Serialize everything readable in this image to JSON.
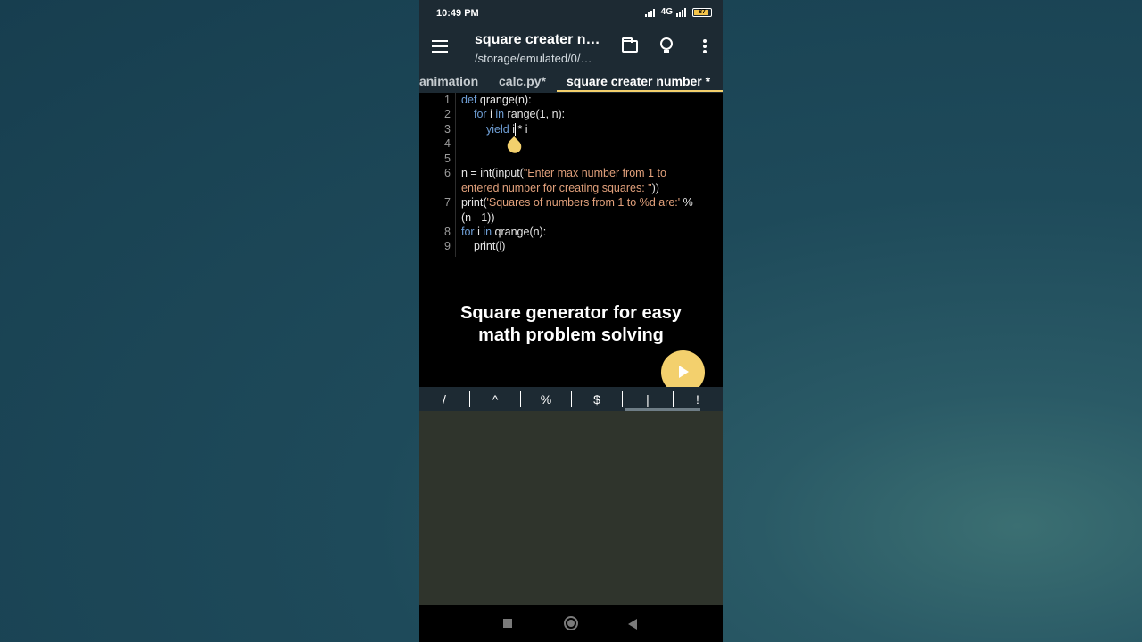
{
  "status_bar": {
    "time": "10:49 PM",
    "network": "4G",
    "battery": "87",
    "battery_level": 0.87
  },
  "app_bar": {
    "title": "square creater n…",
    "subtitle": "/storage/emulated/0/…",
    "menu_icon": "hamburger-icon",
    "folder_icon": "folder-icon",
    "hint_icon": "lightbulb-icon",
    "more_icon": "more-vert-icon"
  },
  "tabs": [
    {
      "label": "animation"
    },
    {
      "label": "calc.py*"
    },
    {
      "label": "square creater number *",
      "active": true
    }
  ],
  "editor": {
    "line_numbers": [
      "1",
      "2",
      "3",
      "4",
      "5",
      "6",
      "7",
      "8",
      "9"
    ],
    "lines": {
      "l1_kw": "def",
      "l1_rest": " qrange(n):",
      "l2_kw1": "for",
      "l2_mid": " i ",
      "l2_kw2": "in",
      "l2_rest": " range(1, n):",
      "l3_kw": "yield",
      "l3_rest": " i * i",
      "l6a_pre": "n = int(input(",
      "l6a_str": "\"Enter max number from 1 to",
      "l6b_str": "entered number for creating squares: \"",
      "l6b_post": "))",
      "l7a_pre": "print(",
      "l7a_str": "'Squares of numbers from 1 to %d are:'",
      "l7a_post": " %",
      "l7b": "(n - 1))",
      "l8_kw1": "for",
      "l8_mid": " i ",
      "l8_kw2": "in",
      "l8_rest": " qrange(n):",
      "l9": "print(i)"
    }
  },
  "overlay_caption": {
    "line1": "Square generator for easy",
    "line2": "math problem solving"
  },
  "run_button": {
    "icon": "play-icon"
  },
  "symbol_bar": {
    "symbols": [
      "/",
      "^",
      "%",
      "$",
      "|",
      "!"
    ]
  },
  "colors": {
    "accent": "#f3d06d",
    "toolbar": "#1d2a33",
    "keyword": "#6f9fd6",
    "string": "#e1a07b"
  }
}
